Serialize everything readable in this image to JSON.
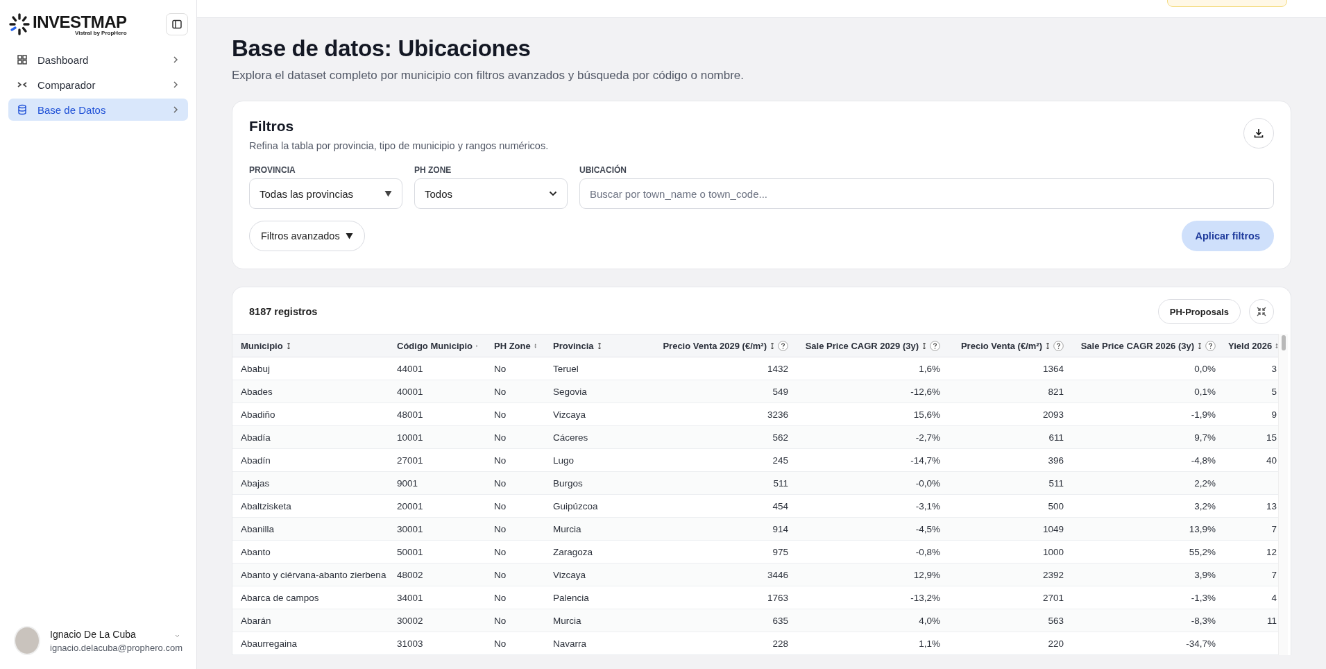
{
  "sidebar": {
    "logo": {
      "name": "INVESTMAP",
      "tagline": "Vistral by PropHero"
    },
    "nav": [
      {
        "label": "Dashboard",
        "selected": false
      },
      {
        "label": "Comparador",
        "selected": false
      },
      {
        "label": "Base de Datos",
        "selected": true
      }
    ],
    "user": {
      "name": "Ignacio De La Cuba",
      "email": "ignacio.delacuba@prophero.com"
    }
  },
  "page": {
    "title": "Base de datos: Ubicaciones",
    "subtitle": "Explora el dataset completo por municipio con filtros avanzados y búsqueda por código o nombre."
  },
  "filters": {
    "title": "Filtros",
    "description": "Refina la tabla por provincia, tipo de municipio y rangos numéricos.",
    "fields": [
      {
        "kind": "dropdown",
        "label": "PROVINCIA",
        "value": "Todas las provincias"
      },
      {
        "kind": "select",
        "label": "PH ZONE",
        "value": "Todos"
      },
      {
        "kind": "search",
        "label": "UBICACIÓN",
        "placeholder": "Buscar por town_name o town_code..."
      }
    ],
    "advanced_button": "Filtros avanzados",
    "apply_button": "Aplicar filtros"
  },
  "table": {
    "count": "8187 registros",
    "proposals_button": "PH-Proposals",
    "columns": [
      {
        "label": "Municipio",
        "kind": "text",
        "help": false
      },
      {
        "label": "Código Municipio",
        "kind": "text",
        "help": false
      },
      {
        "label": "PH Zone",
        "kind": "text",
        "help": false
      },
      {
        "label": "Provincia",
        "kind": "text",
        "help": false
      },
      {
        "label": "Precio Venta 2029 (€/m²)",
        "kind": "number",
        "help": true
      },
      {
        "label": "Sale Price CAGR 2029 (3y)",
        "kind": "number",
        "help": true
      },
      {
        "label": "Precio Venta (€/m²)",
        "kind": "number",
        "help": true
      },
      {
        "label": "Sale Price CAGR 2026 (3y)",
        "kind": "number",
        "help": true
      },
      {
        "label": "Yield 2026",
        "kind": "number",
        "help": false
      }
    ],
    "rows": [
      [
        "Ababuj",
        "44001",
        "No",
        "Teruel",
        "1432",
        "1,6%",
        "1364",
        "0,0%",
        "3"
      ],
      [
        "Abades",
        "40001",
        "No",
        "Segovia",
        "549",
        "-12,6%",
        "821",
        "0,1%",
        "5"
      ],
      [
        "Abadiño",
        "48001",
        "No",
        "Vizcaya",
        "3236",
        "15,6%",
        "2093",
        "-1,9%",
        "9"
      ],
      [
        "Abadía",
        "10001",
        "No",
        "Cáceres",
        "562",
        "-2,7%",
        "611",
        "9,7%",
        "15"
      ],
      [
        "Abadín",
        "27001",
        "No",
        "Lugo",
        "245",
        "-14,7%",
        "396",
        "-4,8%",
        "40"
      ],
      [
        "Abajas",
        "9001",
        "No",
        "Burgos",
        "511",
        "-0,0%",
        "511",
        "2,2%",
        ""
      ],
      [
        "Abaltzisketa",
        "20001",
        "No",
        "Guipúzcoa",
        "454",
        "-3,1%",
        "500",
        "3,2%",
        "13"
      ],
      [
        "Abanilla",
        "30001",
        "No",
        "Murcia",
        "914",
        "-4,5%",
        "1049",
        "13,9%",
        "7"
      ],
      [
        "Abanto",
        "50001",
        "No",
        "Zaragoza",
        "975",
        "-0,8%",
        "1000",
        "55,2%",
        "12"
      ],
      [
        "Abanto y ciérvana-abanto zierbena",
        "48002",
        "No",
        "Vizcaya",
        "3446",
        "12,9%",
        "2392",
        "3,9%",
        "7"
      ],
      [
        "Abarca de campos",
        "34001",
        "No",
        "Palencia",
        "1763",
        "-13,2%",
        "2701",
        "-1,3%",
        "4"
      ],
      [
        "Abarán",
        "30002",
        "No",
        "Murcia",
        "635",
        "4,0%",
        "563",
        "-8,3%",
        "11"
      ],
      [
        "Abaurregaina",
        "31003",
        "No",
        "Navarra",
        "228",
        "1,1%",
        "220",
        "-34,7%",
        ""
      ]
    ]
  }
}
